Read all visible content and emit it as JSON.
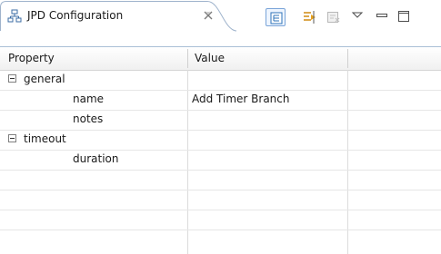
{
  "view": {
    "title": "JPD Configuration",
    "icon": "hierarchy-icon",
    "toolbar": [
      {
        "name": "show-categories-button",
        "icon": "tree-icon"
      },
      {
        "name": "filter-advanced-button",
        "icon": "filter-icon"
      },
      {
        "name": "restore-default-button",
        "icon": "restore-icon"
      },
      {
        "name": "view-menu-button",
        "icon": "chevron-down-icon"
      },
      {
        "name": "minimize-button",
        "icon": "minimize-icon"
      },
      {
        "name": "maximize-button",
        "icon": "maximize-icon"
      }
    ]
  },
  "table": {
    "columns": [
      "Property",
      "Value"
    ],
    "rows": [
      {
        "property": "general",
        "value": "",
        "category": true,
        "expanded": true
      },
      {
        "property": "name",
        "value": "Add Timer Branch",
        "category": false
      },
      {
        "property": "notes",
        "value": "",
        "category": false
      },
      {
        "property": "timeout",
        "value": "",
        "category": true,
        "expanded": true
      },
      {
        "property": "duration",
        "value": "",
        "category": false
      }
    ]
  }
}
